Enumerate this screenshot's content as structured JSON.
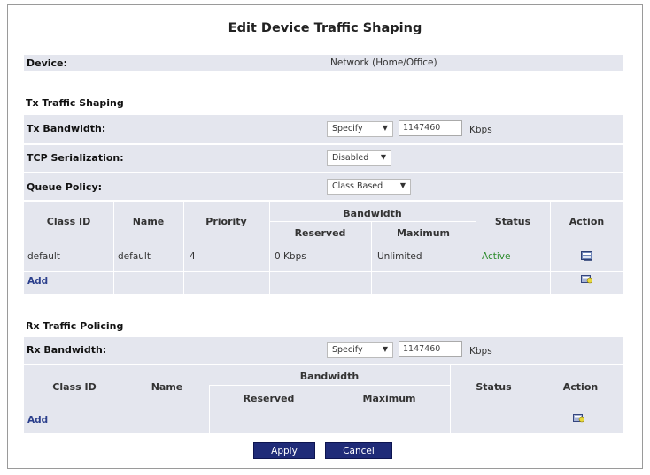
{
  "page": {
    "title": "Edit Device Traffic Shaping"
  },
  "device": {
    "label": "Device:",
    "value": "Network (Home/Office)"
  },
  "tx": {
    "section_title": "Tx Traffic Shaping",
    "bandwidth_label": "Tx Bandwidth:",
    "bandwidth_mode": "Specify",
    "bandwidth_value": "1147460",
    "bandwidth_units": "Kbps",
    "tcp_label": "TCP Serialization:",
    "tcp_value": "Disabled",
    "queue_label": "Queue Policy:",
    "queue_value": "Class Based",
    "table": {
      "headers": {
        "class_id": "Class ID",
        "name": "Name",
        "priority": "Priority",
        "bandwidth": "Bandwidth",
        "reserved": "Reserved",
        "maximum": "Maximum",
        "status": "Status",
        "action": "Action"
      },
      "rows": [
        {
          "class_id": "default",
          "name": "default",
          "priority": "4",
          "reserved": "0 Kbps",
          "maximum": "Unlimited",
          "status": "Active",
          "action_icon": "edit-icon"
        }
      ],
      "add_label": "Add",
      "add_icon": "add-icon"
    }
  },
  "rx": {
    "section_title": "Rx Traffic Policing",
    "bandwidth_label": "Rx Bandwidth:",
    "bandwidth_mode": "Specify",
    "bandwidth_value": "1147460",
    "bandwidth_units": "Kbps",
    "table": {
      "headers": {
        "class_id": "Class ID",
        "name": "Name",
        "bandwidth": "Bandwidth",
        "reserved": "Reserved",
        "maximum": "Maximum",
        "status": "Status",
        "action": "Action"
      },
      "add_label": "Add",
      "add_icon": "add-icon"
    }
  },
  "buttons": {
    "apply": "Apply",
    "cancel": "Cancel"
  },
  "colors": {
    "band": "#e4e6ee",
    "link": "#2b3f8c",
    "active": "#2a8a2a",
    "button": "#1f2b78"
  }
}
